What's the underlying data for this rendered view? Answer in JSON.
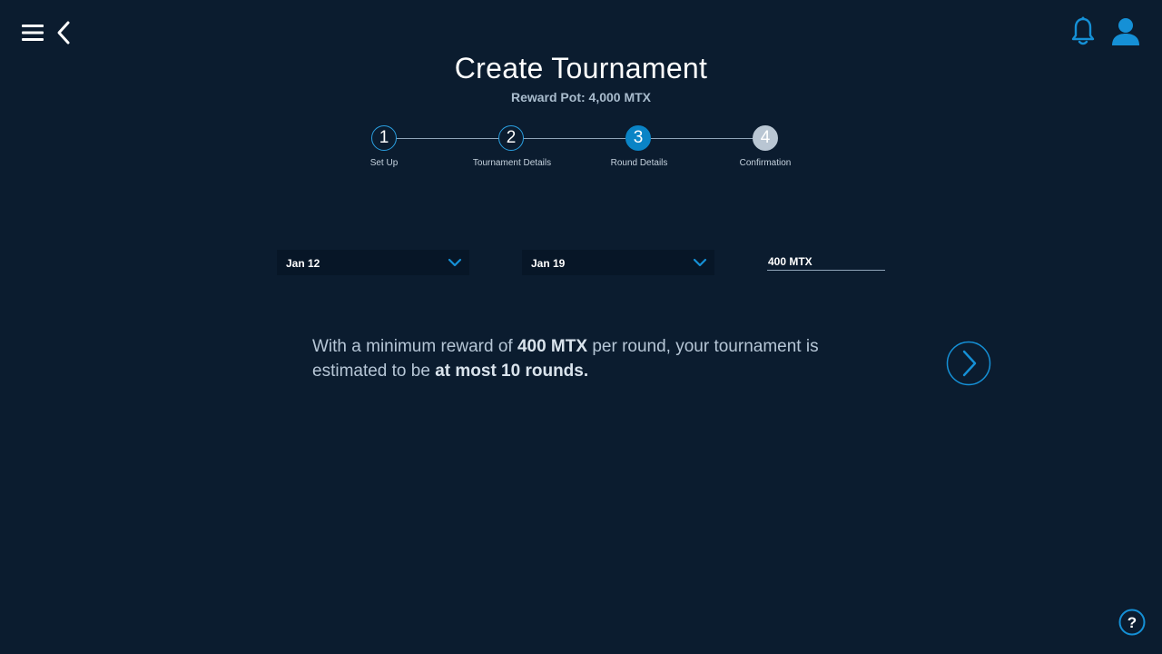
{
  "header": {
    "menu_icon": "hamburger-menu-icon",
    "back_icon": "chevron-left-icon",
    "notifications_icon": "bell-icon",
    "profile_icon": "user-icon"
  },
  "page": {
    "title": "Create Tournament",
    "subtitle": "Reward Pot: 4,000 MTX"
  },
  "stepper": {
    "current_step": 3,
    "steps": [
      {
        "number": "1",
        "label": "Set Up",
        "state": "completed"
      },
      {
        "number": "2",
        "label": "Tournament Details",
        "state": "completed"
      },
      {
        "number": "3",
        "label": "Round Details",
        "state": "active"
      },
      {
        "number": "4",
        "label": "Confirmation",
        "state": "upcoming"
      }
    ]
  },
  "form": {
    "start_date": {
      "value": "Jan 12",
      "icon": "chevron-down-icon"
    },
    "end_date": {
      "value": "Jan 19",
      "icon": "chevron-down-icon"
    },
    "min_reward": {
      "value": "400 MTX"
    }
  },
  "summary": {
    "part1": "With a minimum reward of ",
    "bold1": "400 MTX",
    "part2": " per round, your tournament is estimated to be ",
    "bold2": "at most 10 rounds."
  },
  "actions": {
    "next_icon": "chevron-right-circle-icon",
    "help_icon": "question-mark-circle-icon"
  },
  "colors": {
    "background": "#0b1c2f",
    "accent": "#0a84c6",
    "accent_light": "#2a9fe0",
    "upcoming_step": "#b9c6d3",
    "muted_text": "#b6c6d6"
  }
}
